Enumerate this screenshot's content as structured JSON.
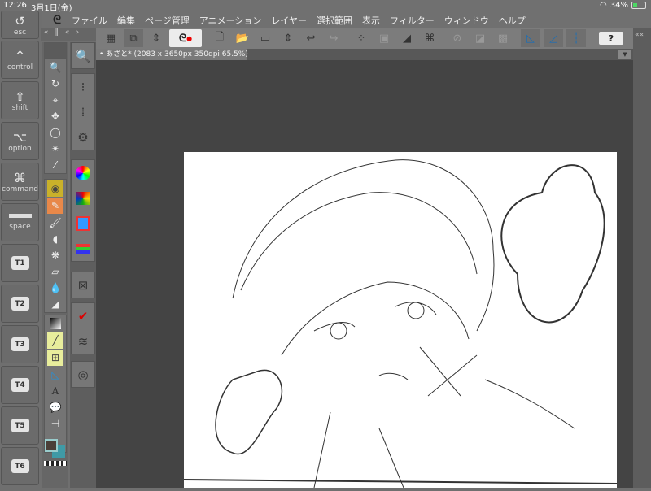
{
  "status_bar": {
    "time": "12:26",
    "date": "3月1日(金)",
    "battery": "34%",
    "battery_level": 0.34
  },
  "keys": [
    {
      "glyph": "↺",
      "label": "esc"
    },
    {
      "glyph": "^",
      "label": "control"
    },
    {
      "glyph": "⇧",
      "label": "shift"
    },
    {
      "glyph": "⌥",
      "label": "option"
    },
    {
      "glyph": "⌘",
      "label": "command"
    },
    {
      "glyph": "",
      "label": "space"
    },
    {
      "tag": "T1"
    },
    {
      "tag": "T2"
    },
    {
      "tag": "T3"
    },
    {
      "tag": "T4"
    },
    {
      "tag": "T5"
    },
    {
      "tag": "T6"
    }
  ],
  "menu": [
    "ファイル",
    "編集",
    "ページ管理",
    "アニメーション",
    "レイヤー",
    "選択範囲",
    "表示",
    "フィルター",
    "ウィンドウ",
    "ヘルプ"
  ],
  "document_tab": "あざと* (2083 x 3650px 350dpi 65.5%)",
  "help_label": "?",
  "colors": {
    "main": "#4a3f38",
    "sub": "#3f9aa6"
  }
}
